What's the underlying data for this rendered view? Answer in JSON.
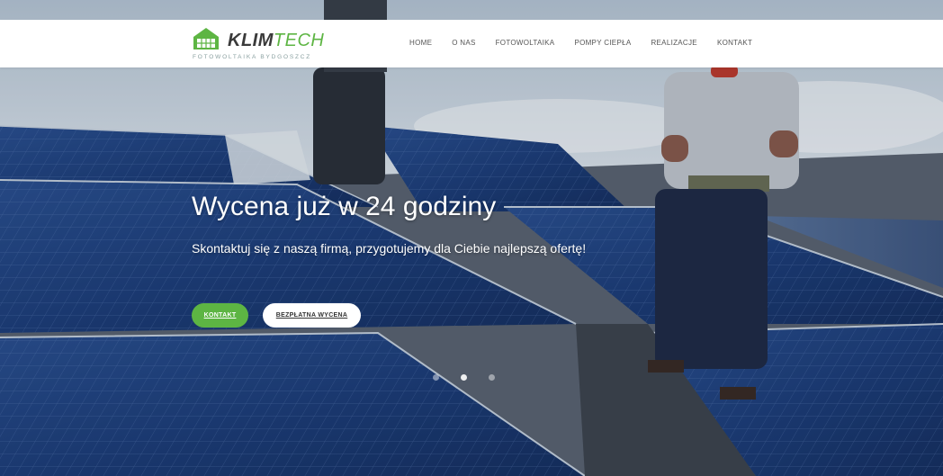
{
  "brand": {
    "name_part1": "KLIM",
    "name_part2": "TECH",
    "tagline": "FOTOWOLTAIKA BYDGOSZCZ",
    "accent_color": "#5db543"
  },
  "nav": {
    "items": [
      "HOME",
      "O NAS",
      "FOTOWOLTAIKA",
      "POMPY CIEPŁA",
      "REALIZACJE",
      "KONTAKT"
    ]
  },
  "hero": {
    "title": "Wycena już w 24 godziny",
    "subtitle": "Skontaktuj się z naszą firmą, przygotujemy dla Ciebie najlepszą ofertę!",
    "button_primary": "KONTAKT",
    "button_secondary": "BEZPŁATNA WYCENA",
    "slides": 3,
    "active_slide": 2
  }
}
